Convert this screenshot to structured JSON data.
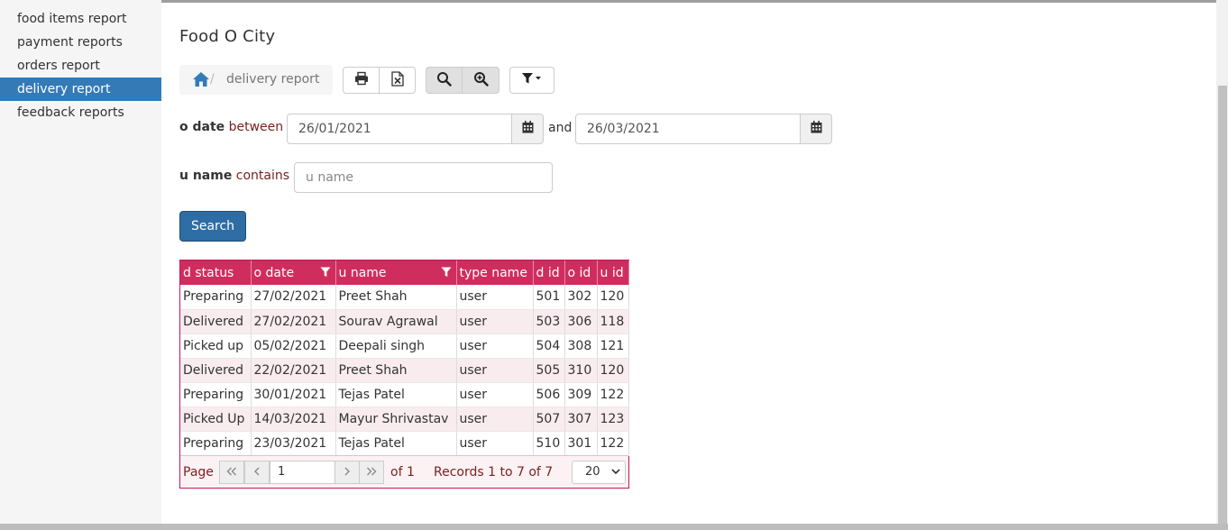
{
  "sidebar": {
    "items": [
      {
        "label": "food items report"
      },
      {
        "label": "payment reports"
      },
      {
        "label": "orders report"
      },
      {
        "label": "delivery report",
        "active": true
      },
      {
        "label": "feedback reports"
      }
    ]
  },
  "app": {
    "title": "Food O City"
  },
  "breadcrumb": {
    "separator": "/",
    "current": "delivery report"
  },
  "toolbar": {
    "icons": [
      "print-icon",
      "excel-icon",
      "search-icon",
      "zoom-in-icon",
      "filter-icon"
    ]
  },
  "filters": {
    "date": {
      "field": "o date",
      "operator": "between",
      "from": "26/01/2021",
      "conjunction": "and",
      "to": "26/03/2021"
    },
    "name": {
      "field": "u name",
      "operator": "contains",
      "placeholder": "u name",
      "value": ""
    },
    "search_label": "Search"
  },
  "grid": {
    "columns": [
      "d status",
      "o date",
      "u name",
      "type name",
      "d id",
      "o id",
      "u id"
    ],
    "rows": [
      [
        "Preparing",
        "27/02/2021",
        "Preet Shah",
        "user",
        "501",
        "302",
        "120"
      ],
      [
        "Delivered",
        "27/02/2021",
        "Sourav Agrawal",
        "user",
        "503",
        "306",
        "118"
      ],
      [
        "Picked up",
        "05/02/2021",
        "Deepali singh",
        "user",
        "504",
        "308",
        "121"
      ],
      [
        "Delivered",
        "22/02/2021",
        "Preet Shah",
        "user",
        "505",
        "310",
        "120"
      ],
      [
        "Preparing",
        "30/01/2021",
        "Tejas Patel",
        "user",
        "506",
        "309",
        "122"
      ],
      [
        "Picked Up",
        "14/03/2021",
        "Mayur Shrivastav",
        "user",
        "507",
        "307",
        "123"
      ],
      [
        "Preparing",
        "23/03/2021",
        "Tejas Patel",
        "user",
        "510",
        "301",
        "122"
      ]
    ],
    "pager": {
      "page_label": "Page",
      "page_value": "1",
      "of_label": "of 1",
      "records_label": "Records 1 to 7 of 7",
      "page_size": "20"
    }
  },
  "colors": {
    "accent": "#337ab7",
    "grid_header": "#d02d5f",
    "button_primary": "#2e6da4"
  }
}
